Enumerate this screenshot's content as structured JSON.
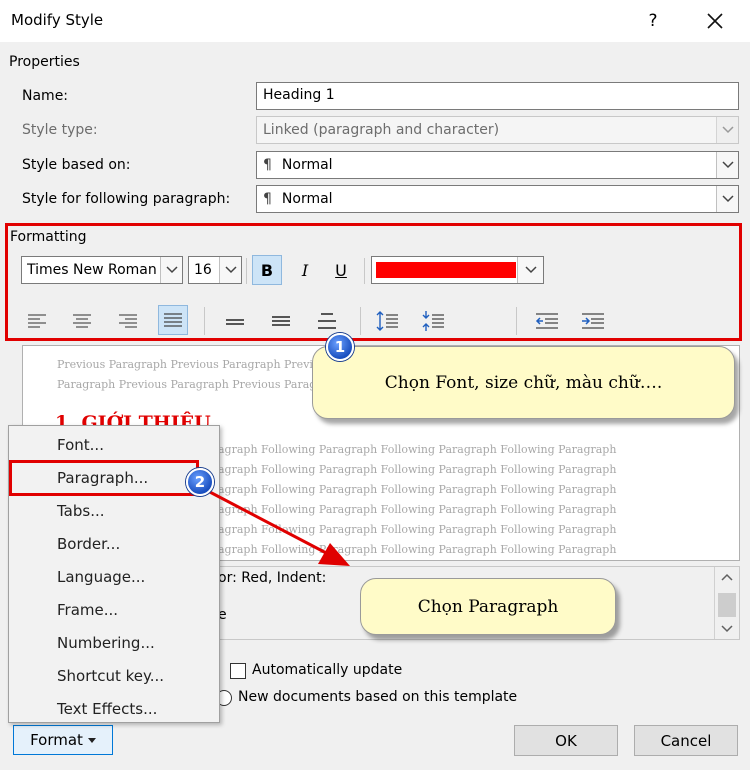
{
  "dialog": {
    "title": "Modify Style",
    "help": "?"
  },
  "properties": {
    "section_label": "Properties",
    "name_label": "Name:",
    "name_value": "Heading 1",
    "style_type_label": "Style type:",
    "style_type_value": "Linked (paragraph and character)",
    "based_on_label": "Style based on:",
    "based_on_value": "Normal",
    "following_label": "Style for following paragraph:",
    "following_value": "Normal",
    "pilcrow": "¶"
  },
  "formatting": {
    "section_label": "Formatting",
    "font_name": "Times New Roman",
    "font_size": "16",
    "bold": "B",
    "italic": "I",
    "underline": "U",
    "font_color": "#ff0000"
  },
  "preview": {
    "previous_lines": [
      "Previous Paragraph Previous Paragraph Previous",
      "Paragraph Previous Paragraph Previous Paragra"
    ],
    "heading": "1. GIỚI THIỆU",
    "following_lines": [
      "agraph Following Paragraph Following Paragraph Following Paragraph",
      "agraph Following Paragraph Following Paragraph Following Paragraph",
      "agraph Following Paragraph Following Paragraph Following Paragraph",
      "agraph Following Paragraph Following Paragraph Following Paragraph",
      "agraph Following Paragraph Following Paragraph Following Paragraph",
      "agraph Following Paragraph Following Paragraph Following Paragraph"
    ]
  },
  "description": {
    "line1": "or: Red, Indent:",
    "line2": "e"
  },
  "callouts": {
    "one": {
      "badge": "1",
      "text": "Chọn Font, size chữ, màu chữ…."
    },
    "two": {
      "badge": "2",
      "text": "Chọn Paragraph"
    }
  },
  "format_menu": {
    "items": [
      "Font...",
      "Paragraph...",
      "Tabs...",
      "Border...",
      "Language...",
      "Frame...",
      "Numbering...",
      "Shortcut key...",
      "Text Effects..."
    ]
  },
  "options": {
    "auto_update": "Automatically update",
    "new_docs": "New documents based on this template"
  },
  "buttons": {
    "format": "Format",
    "ok": "OK",
    "cancel": "Cancel"
  },
  "colors": {
    "highlight_red": "#e10000",
    "accent_blue": "#1a4fbf",
    "callout_fill": "#fffbc8"
  }
}
